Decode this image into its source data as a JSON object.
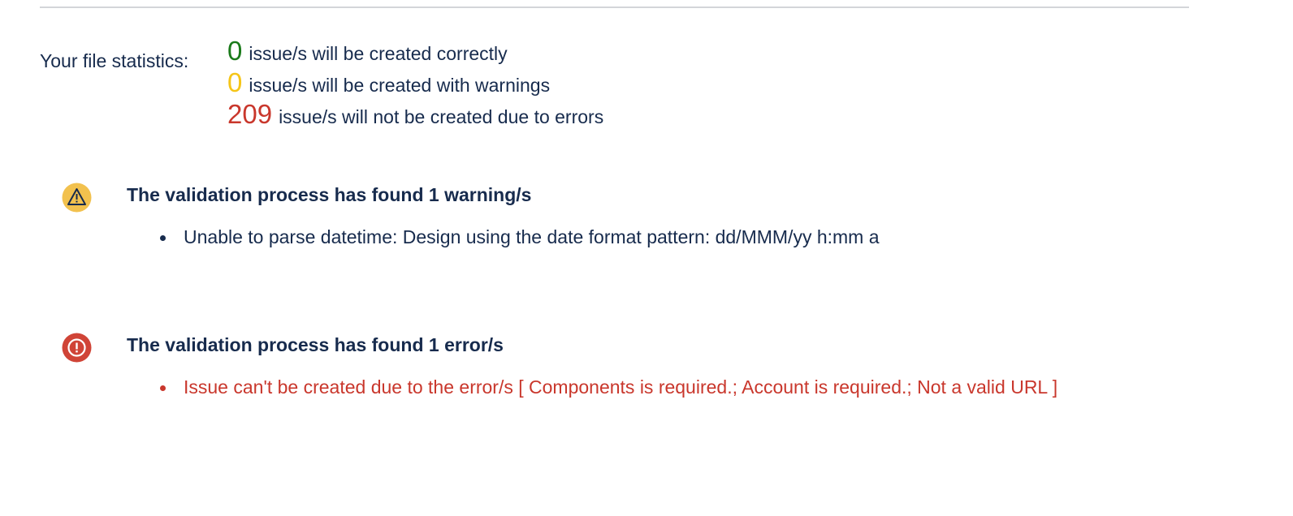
{
  "colors": {
    "success": "#1a7a1a",
    "warning": "#f5c518",
    "error": "#c9372c",
    "text": "#172b4d"
  },
  "stats": {
    "label": "Your file statistics:",
    "rows": [
      {
        "count": "0",
        "text": "issue/s will be created correctly"
      },
      {
        "count": "0",
        "text": "issue/s will be created with warnings"
      },
      {
        "count": "209",
        "text": "issue/s will not be created due to errors"
      }
    ]
  },
  "warnings": {
    "icon": "warning-triangle-icon",
    "title": "The validation process has found 1 warning/s",
    "items": [
      "Unable to parse datetime: Design using the date format pattern: dd/MMM/yy h:mm a"
    ]
  },
  "errors": {
    "icon": "error-exclamation-icon",
    "title": "The validation process has found 1 error/s",
    "items": [
      "Issue can't be created due to the error/s [ Components is required.; Account is required.; Not a valid URL ]"
    ]
  }
}
